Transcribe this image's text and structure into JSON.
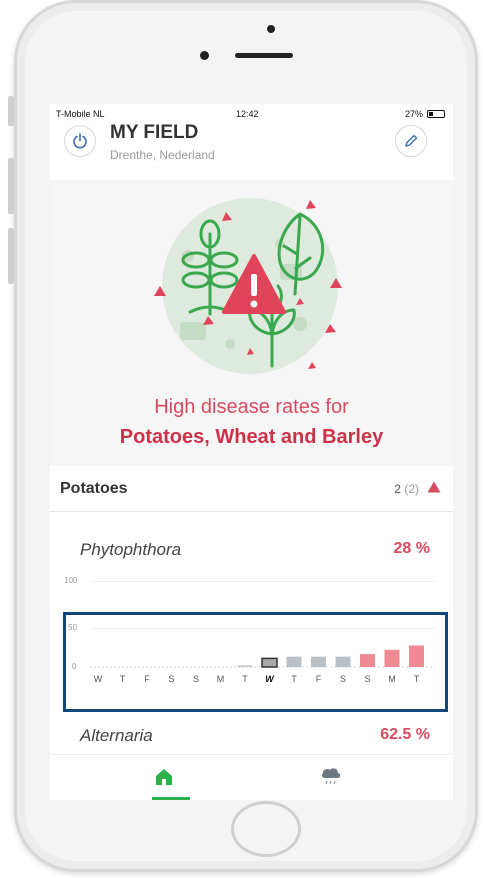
{
  "status_bar": {
    "carrier": "T-Mobile NL",
    "time": "12:42",
    "battery": "27%"
  },
  "header": {
    "title": "MY FIELD",
    "location": "Drenthe, Nederland",
    "power_icon": "power-icon",
    "edit_icon": "pencil-icon"
  },
  "alert": {
    "line1": "High disease rates for",
    "line2": "Potatoes, Wheat and Barley",
    "illustration_icon": "plants-warning-illustration"
  },
  "crop": {
    "name": "Potatoes",
    "count": "2",
    "count_total": "(2)",
    "alert_icon": "warning-triangle-icon"
  },
  "diseases": [
    {
      "name": "Phytophthora",
      "percent": "28 %"
    },
    {
      "name": "Alternaria",
      "percent": "62.5 %"
    }
  ],
  "chart_data": {
    "type": "bar",
    "ylim": [
      0,
      100
    ],
    "y_ticks": [
      "100",
      "50",
      "0"
    ],
    "categories": [
      "W",
      "T",
      "F",
      "S",
      "S",
      "M",
      "T",
      "W",
      "T",
      "F",
      "S",
      "S",
      "M",
      "T"
    ],
    "today_index": 7,
    "values": [
      0,
      0,
      0,
      0,
      0,
      0,
      2,
      10,
      12,
      12,
      12,
      15,
      20,
      25
    ],
    "colors": {
      "past": "#c9c9c9",
      "today": "#a9a9a9",
      "forecast_low": "#b9c0c6",
      "forecast_high": "#f08a92"
    }
  },
  "bottom_nav": {
    "home_icon": "home-icon",
    "weather_icon": "cloud-rain-icon",
    "accent": "#2bb04a"
  }
}
